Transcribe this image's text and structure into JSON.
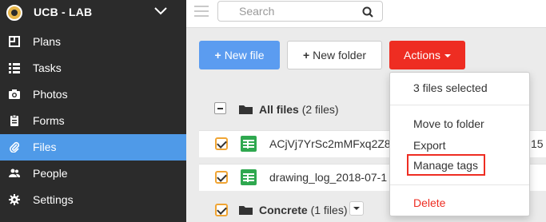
{
  "sidebar": {
    "title": "UCB - LAB",
    "items": [
      {
        "label": "Plans",
        "icon": "plans-icon"
      },
      {
        "label": "Tasks",
        "icon": "tasks-icon"
      },
      {
        "label": "Photos",
        "icon": "camera-icon"
      },
      {
        "label": "Forms",
        "icon": "clipboard-icon"
      },
      {
        "label": "Files",
        "icon": "paperclip-icon",
        "active": true
      },
      {
        "label": "People",
        "icon": "people-icon"
      },
      {
        "label": "Settings",
        "icon": "gear-icon"
      }
    ]
  },
  "topbar": {
    "search_placeholder": "Search"
  },
  "toolbar": {
    "new_file": "New file",
    "new_folder": "New folder",
    "actions": "Actions"
  },
  "files": {
    "all_files_label": "All files",
    "all_files_count": "(2 files)",
    "rows": [
      {
        "name": "ACjVj7YrSc2mMFxq2Z8",
        "tail": "15",
        "checked": true
      },
      {
        "name": "drawing_log_2018-07-1",
        "tail": "",
        "checked": true
      }
    ],
    "folder": {
      "label": "Concrete",
      "count": "(1 files)",
      "checked": true
    }
  },
  "actions_menu": {
    "header": "3 files selected",
    "items": [
      "Move to folder",
      "Export",
      "Manage tags"
    ],
    "delete": "Delete",
    "highlighted": "Manage tags"
  },
  "colors": {
    "accent": "#5b9cf0",
    "danger": "#ee2d22",
    "sidebar_bg": "#2b2b2b",
    "checkbox": "#f0a534",
    "sheet_green": "#2fa84f"
  }
}
